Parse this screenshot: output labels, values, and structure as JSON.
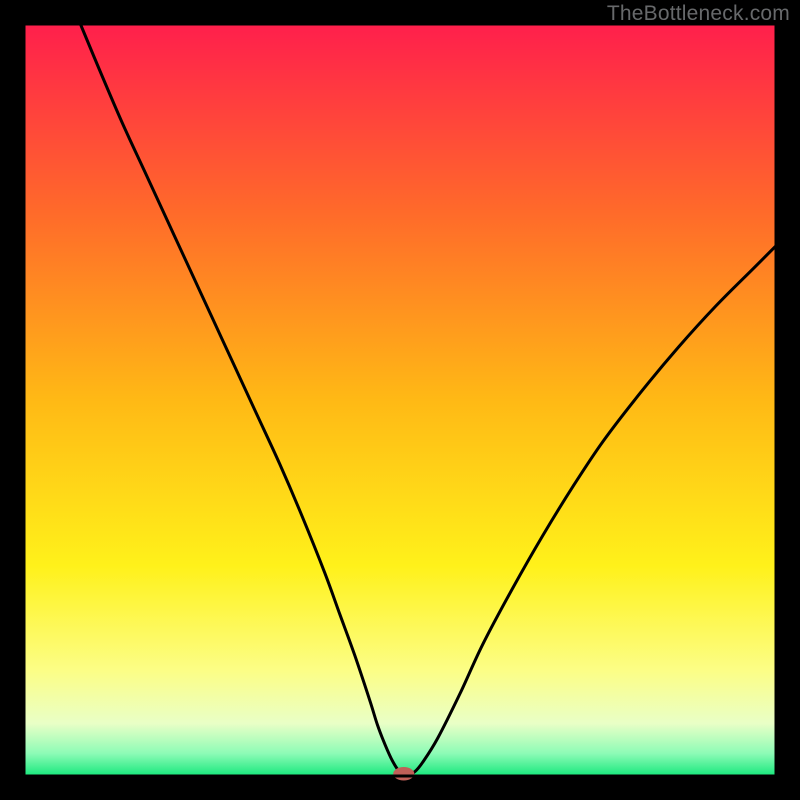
{
  "watermark": "TheBottleneck.com",
  "chart_data": {
    "type": "line",
    "title": "",
    "xlabel": "",
    "ylabel": "",
    "xlim": [
      0,
      100
    ],
    "ylim": [
      0,
      100
    ],
    "grid": false,
    "legend": false,
    "background_gradient_stops": [
      {
        "offset": 0,
        "color": "#ff1f4c"
      },
      {
        "offset": 25,
        "color": "#ff6a2a"
      },
      {
        "offset": 50,
        "color": "#ffb915"
      },
      {
        "offset": 72,
        "color": "#fff11a"
      },
      {
        "offset": 86,
        "color": "#fcfe86"
      },
      {
        "offset": 93,
        "color": "#e9ffc6"
      },
      {
        "offset": 97,
        "color": "#8dfbb6"
      },
      {
        "offset": 100,
        "color": "#17e87c"
      }
    ],
    "series": [
      {
        "name": "bottleneck-curve",
        "color": "#000000",
        "x": [
          7.5,
          10,
          13,
          16,
          19,
          22,
          25,
          28,
          31,
          34,
          37,
          40,
          42,
          44,
          46,
          47,
          48,
          49,
          50,
          51,
          52,
          53,
          55,
          58,
          61,
          65,
          69,
          73,
          77,
          82,
          87,
          92,
          97,
          100
        ],
        "values": [
          100,
          94,
          87,
          80.5,
          74,
          67.5,
          61,
          54.5,
          48,
          41.5,
          34.5,
          27,
          21.5,
          16,
          10,
          6.8,
          4.2,
          2.0,
          0.5,
          0.1,
          0.6,
          1.8,
          5.0,
          11,
          17.5,
          25,
          32,
          38.5,
          44.5,
          51,
          57,
          62.5,
          67.5,
          70.5
        ]
      }
    ],
    "marker": {
      "name": "optimal-point",
      "x": 50.5,
      "y": 0.3,
      "rx": 1.4,
      "ry": 0.9,
      "color": "#c06058"
    },
    "frame": {
      "inner_box": {
        "x": 3,
        "y": 3,
        "w": 94,
        "h": 94
      },
      "stroke": "#000000",
      "stroke_width": 3
    }
  }
}
